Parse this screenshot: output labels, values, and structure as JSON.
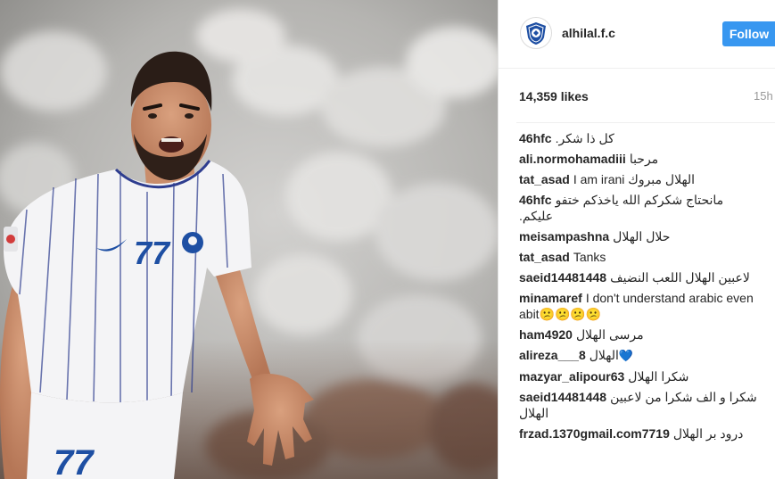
{
  "post": {
    "username": "alhilal.f.c",
    "follow_label": "Follow",
    "likes": "14,359 likes",
    "time_ago": "15h"
  },
  "comments": [
    {
      "user": "46hfc",
      "text": "كل ذا شكر."
    },
    {
      "user": "ali.normohamadiii",
      "text": "مرحبا"
    },
    {
      "user": "tat_asad",
      "text": "الهلال مبروك I am irani"
    },
    {
      "user": "46hfc",
      "text": "مانحتاج شكركم الله ياخذكم ختفو عليكم."
    },
    {
      "user": "meisampashna",
      "text": "حلال الهلال"
    },
    {
      "user": "tat_asad",
      "text": "Tanks"
    },
    {
      "user": "saeid14481448",
      "text": "لاعبين الهلال اللعب النضيف"
    },
    {
      "user": "minamaref",
      "text": "I don't understand arabic even abit😕😕😕😕"
    },
    {
      "user": "ham4920",
      "text": "مرسى الهلال"
    },
    {
      "user": "alireza___8",
      "text": "الهلال",
      "heart": "💙"
    },
    {
      "user": "mazyar_alipour63",
      "text": "شكرا الهلال"
    },
    {
      "user": "saeid14481448",
      "text": "شكرا و الف شكرا من لاعبين الهلال"
    },
    {
      "user": "frzad.1370gmail.com7719",
      "text": "درود بر الهلال"
    }
  ],
  "photo": {
    "jersey_number": "77"
  },
  "colors": {
    "follow_button": "#3897f0",
    "jersey": "#f4f4f6",
    "jersey_stripes": "#2e3d8f",
    "club_blue": "#1e4fa3"
  },
  "icons": {
    "avatar": "al-hilal-crest-icon",
    "jersey_crest": "club-crest-icon",
    "jersey_logo": "swoosh-icon"
  }
}
